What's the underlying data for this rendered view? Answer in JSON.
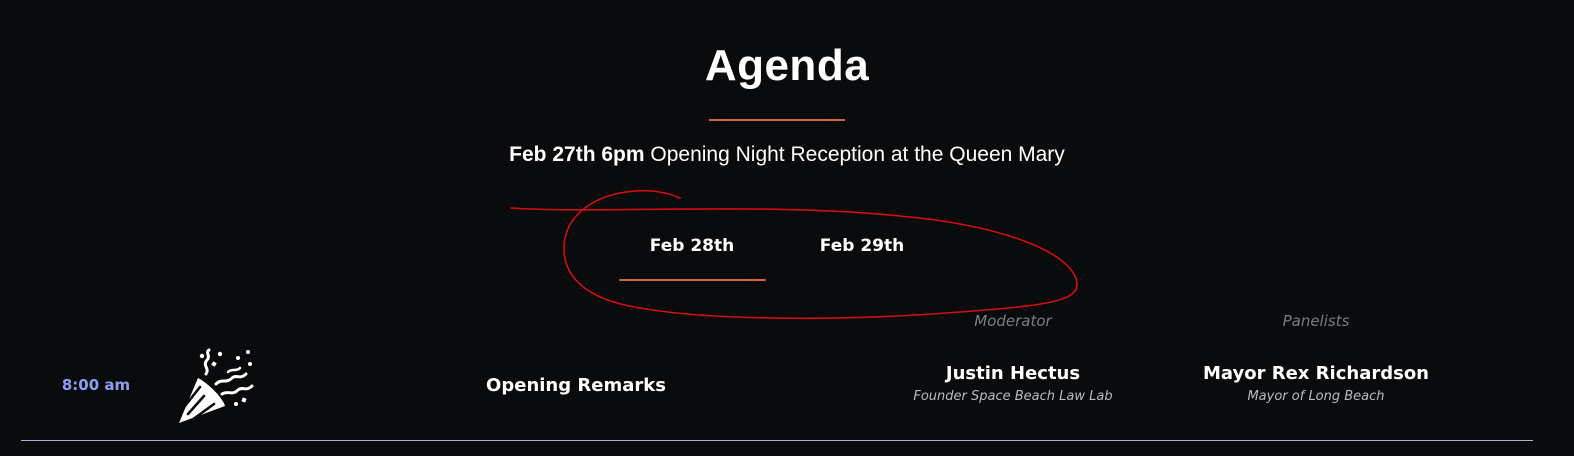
{
  "page": {
    "title": "Agenda",
    "accent_color": "#c96a37",
    "background_color": "#0a0b0d"
  },
  "reception": {
    "date": "Feb 27th 6pm",
    "description": "Opening Night Reception at the Queen Mary"
  },
  "tabs": [
    {
      "label": "Feb 28th",
      "active": true
    },
    {
      "label": "Feb 29th",
      "active": false
    }
  ],
  "agenda": {
    "roles": {
      "moderator": "Moderator",
      "panelists": "Panelists"
    },
    "rows": [
      {
        "time": "8:00 am",
        "icon": "party-popper-icon",
        "title": "Opening Remarks",
        "moderator": {
          "name": "Justin Hectus",
          "title": "Founder Space Beach Law Lab"
        },
        "panelist": {
          "name": "Mayor Rex Richardson",
          "title": "Mayor of Long Beach"
        }
      }
    ],
    "time_color": "#8f9ff0"
  },
  "annotation": {
    "type": "hand-drawn circle",
    "color": "#d40f0f"
  }
}
